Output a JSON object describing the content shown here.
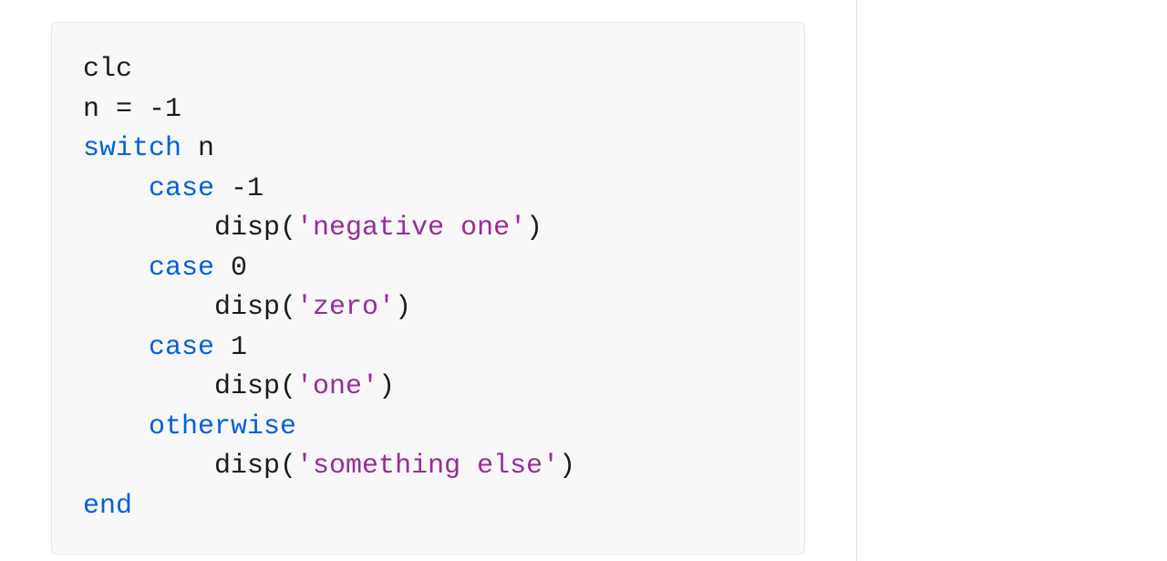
{
  "code": {
    "line1": "clc",
    "line2_lhs": "n = ",
    "line2_rhs": "-1",
    "line3_kw": "switch",
    "line3_var": " n",
    "line4_kw": "case",
    "line4_val": " -1",
    "line5_fn": "disp(",
    "line5_str": "'negative one'",
    "line5_close": ")",
    "line6_kw": "case",
    "line6_val": " 0",
    "line7_fn": "disp(",
    "line7_str": "'zero'",
    "line7_close": ")",
    "line8_kw": "case",
    "line8_val": " 1",
    "line9_fn": "disp(",
    "line9_str": "'one'",
    "line9_close": ")",
    "line10_kw": "otherwise",
    "line11_fn": "disp(",
    "line11_str": "'something else'",
    "line11_close": ")",
    "line12_kw": "end"
  }
}
